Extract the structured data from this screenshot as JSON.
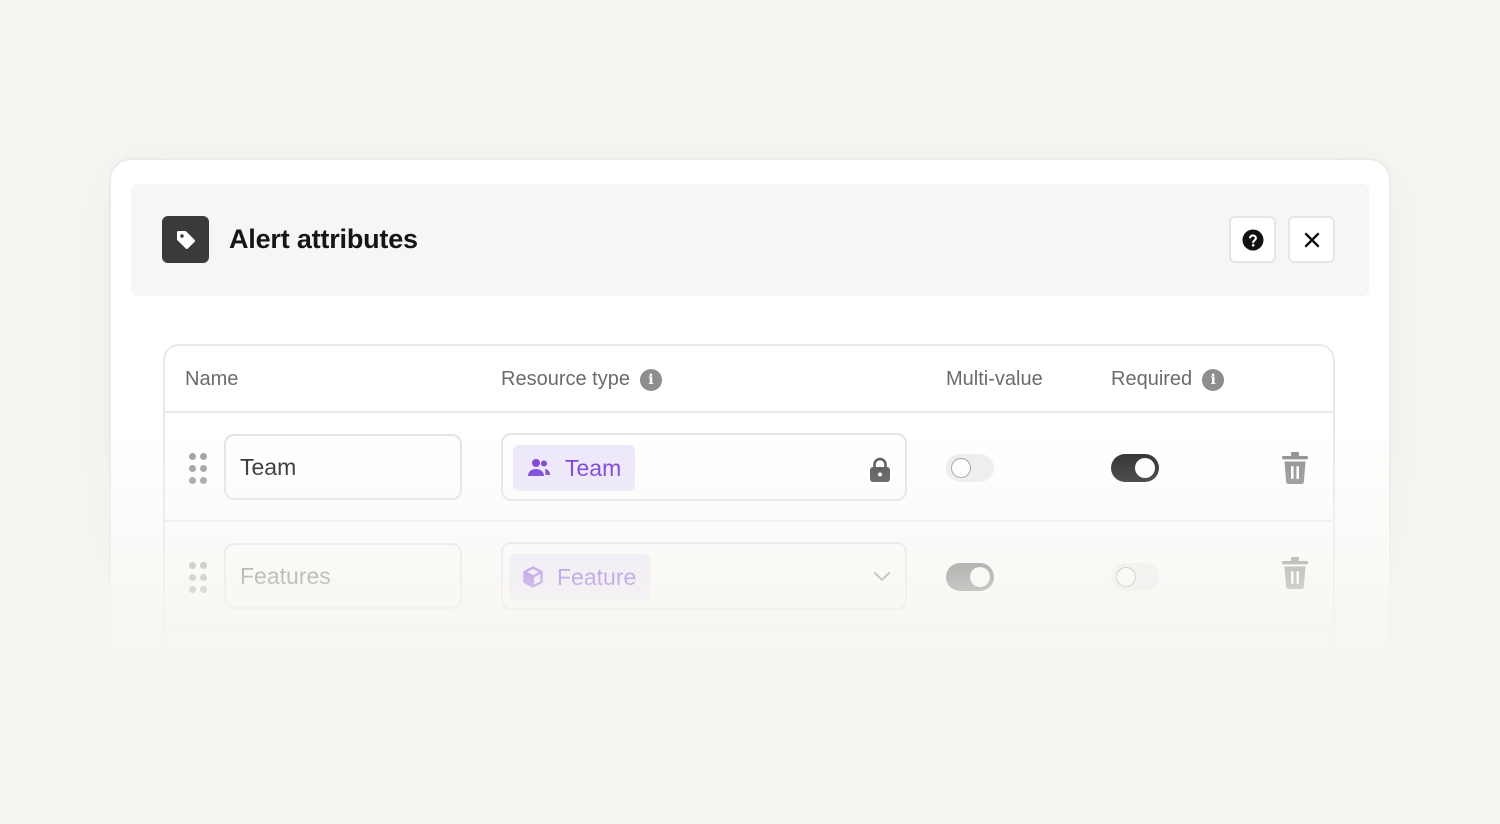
{
  "modal": {
    "title": "Alert attributes",
    "header_icon": "tag-icon",
    "help_icon": "help-circle-icon",
    "close_icon": "close-icon"
  },
  "table": {
    "columns": {
      "name": "Name",
      "resource_type": "Resource type",
      "multi_value": "Multi-value",
      "required": "Required"
    },
    "rows": [
      {
        "name": "Team",
        "resource_type": "Team",
        "resource_icon": "users-icon",
        "resource_action_icon": "lock-icon",
        "multi_value": false,
        "required": true
      },
      {
        "name": "Features",
        "resource_type": "Feature",
        "resource_icon": "cube-icon",
        "resource_action_icon": "chevron-down-icon",
        "multi_value": true,
        "required": false
      }
    ]
  },
  "colors": {
    "accent_purple": "#6b2ed3",
    "pill_bg": "#ece6fb",
    "toggle_on": "#1f1f21",
    "background": "#f7f5f1"
  }
}
